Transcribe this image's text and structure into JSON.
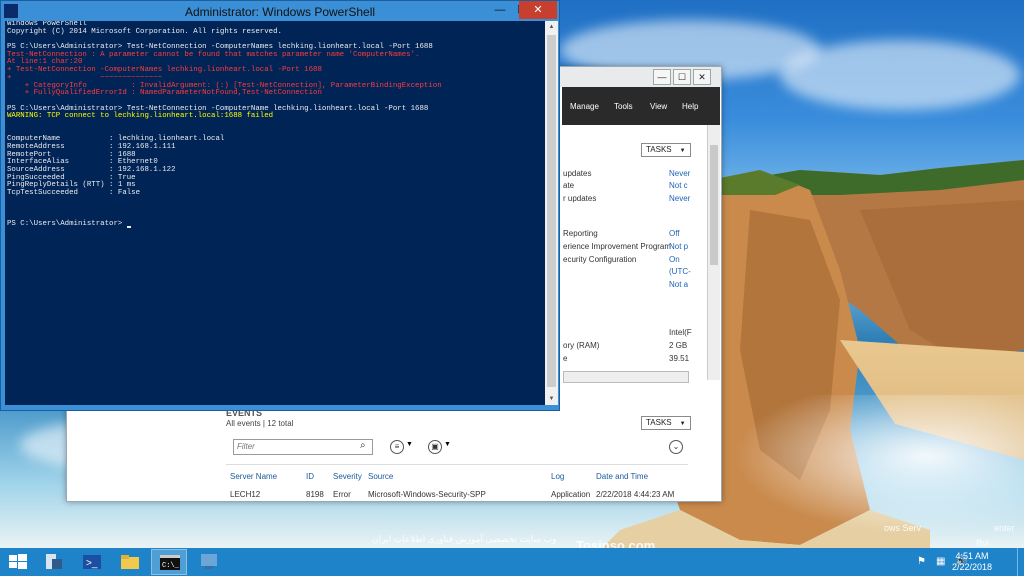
{
  "powershell": {
    "title": "Administrator: Windows PowerShell",
    "lines": [
      {
        "text": "Windows PowerShell",
        "color": "white"
      },
      {
        "text": "Copyright (C) 2014 Microsoft Corporation. All rights reserved.",
        "color": "white"
      },
      {
        "text": "",
        "color": "white"
      },
      {
        "text": "PS C:\\Users\\Administrator> Test-NetConnection -ComputerNames lechking.lionheart.local -Port 1688",
        "color": "white"
      },
      {
        "text": "Test-NetConnection : A parameter cannot be found that matches parameter name 'ComputerNames'.",
        "color": "err"
      },
      {
        "text": "At line:1 char:20",
        "color": "err"
      },
      {
        "text": "+ Test-NetConnection -ComputerNames lechking.lionheart.local -Port 1688",
        "color": "err"
      },
      {
        "text": "+                    ~~~~~~~~~~~~~~",
        "color": "err"
      },
      {
        "text": "    + CategoryInfo          : InvalidArgument: (:) [Test-NetConnection], ParameterBindingException",
        "color": "err"
      },
      {
        "text": "    + FullyQualifiedErrorId : NamedParameterNotFound,Test-NetConnection",
        "color": "err"
      },
      {
        "text": "",
        "color": "white"
      },
      {
        "text": "PS C:\\Users\\Administrator> Test-NetConnection -ComputerName lechking.lionheart.local -Port 1688",
        "color": "white"
      },
      {
        "text": "WARNING: TCP connect to lechking.lionheart.local:1688 failed",
        "color": "warn"
      },
      {
        "text": "",
        "color": "white"
      },
      {
        "text": "",
        "color": "white"
      },
      {
        "text": "ComputerName           : lechking.lionheart.local",
        "color": "white"
      },
      {
        "text": "RemoteAddress          : 192.168.1.111",
        "color": "white"
      },
      {
        "text": "RemotePort             : 1688",
        "color": "white"
      },
      {
        "text": "InterfaceAlias         : Ethernet0",
        "color": "white"
      },
      {
        "text": "SourceAddress          : 192.168.1.122",
        "color": "white"
      },
      {
        "text": "PingSucceeded          : True",
        "color": "white"
      },
      {
        "text": "PingReplyDetails (RTT) : 1 ms",
        "color": "white"
      },
      {
        "text": "TcpTestSucceeded       : False",
        "color": "white"
      },
      {
        "text": "",
        "color": "white"
      },
      {
        "text": "",
        "color": "white"
      },
      {
        "text": "",
        "color": "white"
      }
    ],
    "prompt": "PS C:\\Users\\Administrator> ",
    "minimize": "—",
    "maximize": "☐",
    "close": "✕"
  },
  "server_manager": {
    "menu": [
      "Manage",
      "Tools",
      "View",
      "Help"
    ],
    "tasks_label": "TASKS",
    "properties": [
      {
        "label": "updates",
        "value": "Never"
      },
      {
        "label": "ate",
        "value": "Not c"
      },
      {
        "label": "r updates",
        "value": "Never"
      },
      {
        "label": "Reporting",
        "value": "Off"
      },
      {
        "label": "erience Improvement Program",
        "value": "Not p"
      },
      {
        "label": "ecurity Configuration",
        "value": "On"
      },
      {
        "label": "",
        "value": "(UTC-"
      },
      {
        "label": "",
        "value": "Not a"
      }
    ],
    "hardware": [
      {
        "label": "",
        "value": "Intel(F"
      },
      {
        "label": "ory (RAM)",
        "value": "2 GB"
      },
      {
        "label": "e",
        "value": "39.51"
      }
    ],
    "events": {
      "title": "EVENTS",
      "subtitle": "All events | 12 total",
      "tasks_label": "TASKS",
      "filter_placeholder": "Filter",
      "columns": [
        "Server Name",
        "ID",
        "Severity",
        "Source",
        "Log",
        "Date and Time"
      ],
      "rows": [
        [
          "LECH12",
          "8198",
          "Error",
          "Microsoft-Windows-Security-SPP",
          "Application",
          "2/22/2018 4:44:23 AM"
        ]
      ]
    },
    "overlay_text": [
      "ows Serv",
      "enter",
      "Bui"
    ]
  },
  "taskbar": {
    "time": "4:51 AM",
    "date": "2/22/2018"
  },
  "watermark": {
    "brand": "Tosinso.com",
    "tagline": "وب سایت تخصصی آموزش فناوری اطلاعات ایران"
  },
  "colors": {
    "console_bg": "#012456",
    "console_text": "#eeedf0",
    "error": "#ff3b3b",
    "warning": "#ffff00",
    "taskbar": "#1e83c8",
    "title_accent": "#3b8fd6"
  }
}
